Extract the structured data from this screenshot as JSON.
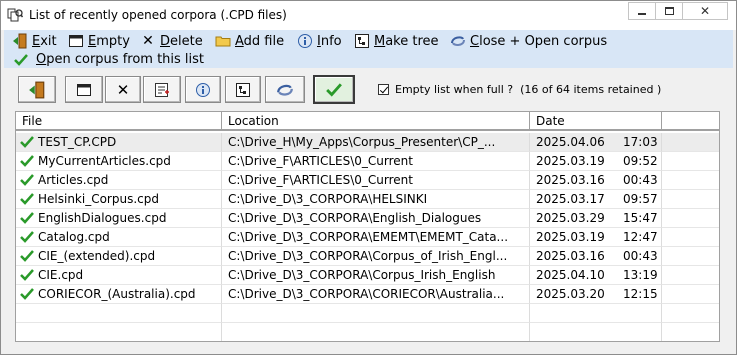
{
  "window": {
    "title": "List of recently opened corpora (.CPD files)"
  },
  "menu": [
    {
      "id": "exit",
      "label": "Exit",
      "icon": "exit-door-icon"
    },
    {
      "id": "empty",
      "label": "Empty",
      "icon": "window-icon"
    },
    {
      "id": "delete",
      "label": "Delete",
      "icon": "x-icon"
    },
    {
      "id": "addfile",
      "label": "Add file",
      "icon": "folder-icon"
    },
    {
      "id": "info",
      "label": "Info",
      "icon": "info-icon"
    },
    {
      "id": "maketree",
      "label": "Make tree",
      "icon": "tree-icon"
    },
    {
      "id": "closeopen",
      "label": "Close + Open corpus",
      "icon": "swap-icon"
    }
  ],
  "menu_row2": {
    "label": "Open corpus from this list",
    "icon": "check-icon"
  },
  "toolbar": {
    "buttons": [
      "exit-door-icon",
      "window-icon",
      "x-icon",
      "list-add-icon",
      "info-icon",
      "tree-icon",
      "swap-icon",
      "check-icon"
    ],
    "checkbox_label": "Empty list when full ?",
    "count_text": "(16 of 64 items retained )",
    "checked": true
  },
  "table": {
    "columns": [
      "File",
      "Location",
      "Date"
    ],
    "rows": [
      {
        "file": "TEST_CP.CPD",
        "location": "C:\\Drive_H\\My_Apps\\Corpus_Presenter\\CP_...",
        "date": "2025.04.06",
        "time": "17:03"
      },
      {
        "file": "MyCurrentArticles.cpd",
        "location": "C:\\Drive_F\\ARTICLES\\0_Current",
        "date": "2025.03.19",
        "time": "09:52"
      },
      {
        "file": "Articles.cpd",
        "location": "C:\\Drive_F\\ARTICLES\\0_Current",
        "date": "2025.03.16",
        "time": "00:43"
      },
      {
        "file": "Helsinki_Corpus.cpd",
        "location": "C:\\Drive_D\\3_CORPORA\\HELSINKI",
        "date": "2025.03.17",
        "time": "09:57"
      },
      {
        "file": "EnglishDialogues.cpd",
        "location": "C:\\Drive_D\\3_CORPORA\\English_Dialogues",
        "date": "2025.03.29",
        "time": "15:47"
      },
      {
        "file": "Catalog.cpd",
        "location": "C:\\Drive_D\\3_CORPORA\\EMEMT\\EMEMT_Cata...",
        "date": "2025.03.19",
        "time": "12:47"
      },
      {
        "file": "CIE_(extended).cpd",
        "location": "C:\\Drive_D\\3_CORPORA\\Corpus_of_Irish_Engl...",
        "date": "2025.03.16",
        "time": "00:43"
      },
      {
        "file": "CIE.cpd",
        "location": "C:\\Drive_D\\3_CORPORA\\Corpus_Irish_English",
        "date": "2025.04.10",
        "time": "13:19"
      },
      {
        "file": "CORIECOR_(Australia).cpd",
        "location": "C:\\Drive_D\\3_CORPORA\\CORIECOR\\Australia...",
        "date": "2025.03.20",
        "time": "12:15"
      }
    ]
  },
  "colors": {
    "menu_bg": "#d8e6f6",
    "check_green": "#2a9a2a",
    "ok_button_bg": "#e2f1df"
  }
}
